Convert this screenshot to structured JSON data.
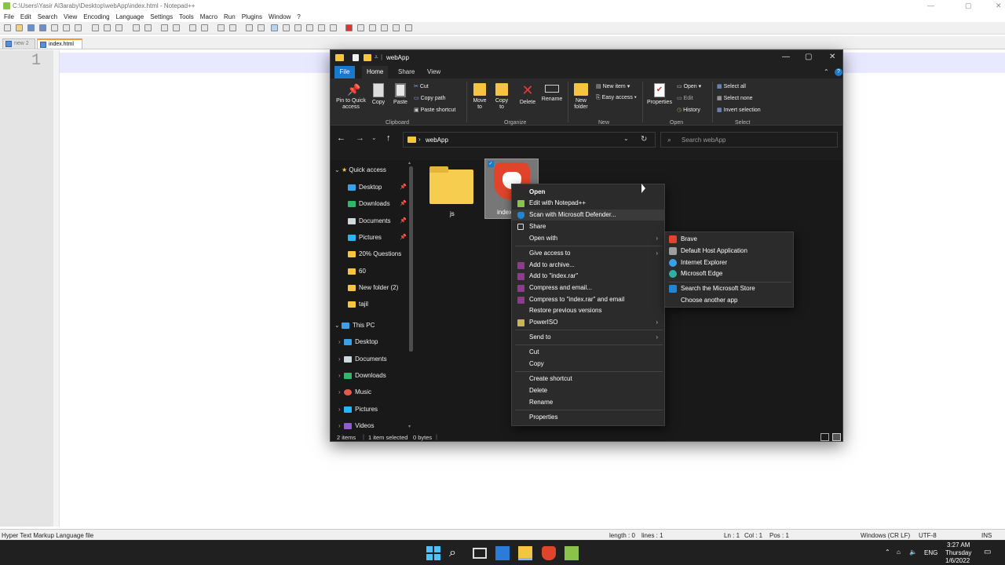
{
  "notepad": {
    "title": "C:\\Users\\Yasir Al3araby\\Desktop\\webApp\\index.html - Notepad++",
    "menu": [
      "File",
      "Edit",
      "Search",
      "View",
      "Encoding",
      "Language",
      "Settings",
      "Tools",
      "Macro",
      "Run",
      "Plugins",
      "Window",
      "?"
    ],
    "tabs": [
      {
        "label": "new 2"
      },
      {
        "label": "index.html"
      }
    ],
    "line_number": "1",
    "status": {
      "file_type": "Hyper Text Markup Language file",
      "length": "length : 0",
      "lines": "lines : 1",
      "ln": "Ln : 1",
      "col": "Col : 1",
      "pos": "Pos : 1",
      "eol": "Windows (CR LF)",
      "encoding": "UTF-8",
      "mode": "INS"
    }
  },
  "explorer": {
    "title": "webApp",
    "ribbon_tabs": [
      "File",
      "Home",
      "Share",
      "View"
    ],
    "clipboard": {
      "pin": "Pin to Quick access",
      "copy": "Copy",
      "paste": "Paste",
      "cut": "Cut",
      "copy_path": "Copy path",
      "paste_shortcut": "Paste shortcut",
      "group": "Clipboard"
    },
    "organize": {
      "move_to": "Move to",
      "copy_to": "Copy to",
      "delete": "Delete",
      "rename": "Rename",
      "group": "Organize"
    },
    "new": {
      "new_folder": "New folder",
      "new_item": "New item",
      "easy_access": "Easy access",
      "group": "New"
    },
    "open": {
      "properties": "Properties",
      "open": "Open",
      "edit": "Edit",
      "history": "History",
      "group": "Open"
    },
    "select": {
      "select_all": "Select all",
      "select_none": "Select none",
      "invert": "Invert selection",
      "group": "Select"
    },
    "address": "webApp",
    "search_placeholder": "Search webApp",
    "nav": {
      "quick_access": "Quick access",
      "quick_items": [
        "Desktop",
        "Downloads",
        "Documents",
        "Pictures",
        "20% Questions",
        "60",
        "New folder (2)",
        "tajil"
      ],
      "this_pc": "This PC",
      "pc_items": [
        "Desktop",
        "Documents",
        "Downloads",
        "Music",
        "Pictures",
        "Videos"
      ]
    },
    "files": [
      {
        "name": "js"
      },
      {
        "name": "index"
      }
    ],
    "status": {
      "items": "2 items",
      "selected": "1 item selected",
      "size": "0 bytes"
    }
  },
  "context_menu": {
    "items": [
      "Open",
      "Edit with Notepad++",
      "Scan with Microsoft Defender...",
      "Share",
      "Open with",
      "Give access to",
      "Add to archive...",
      "Add to \"index.rar\"",
      "Compress and email...",
      "Compress to \"index.rar\" and email",
      "Restore previous versions",
      "PowerISO",
      "Send to",
      "Cut",
      "Copy",
      "Create shortcut",
      "Delete",
      "Rename",
      "Properties"
    ]
  },
  "open_with_submenu": {
    "items": [
      "Brave",
      "Default Host Application",
      "Internet Explorer",
      "Microsoft Edge",
      "Search the Microsoft Store",
      "Choose another app"
    ]
  },
  "tray": {
    "lang": "ENG",
    "time": "3:27 AM",
    "day": "Thursday",
    "date": "1/6/2022"
  },
  "colors": {
    "accent": "#1979ca",
    "explorer_bg": "#191919",
    "menu_bg": "#2b2b2b",
    "brave": "#e0452b",
    "folder": "#f5c542"
  }
}
